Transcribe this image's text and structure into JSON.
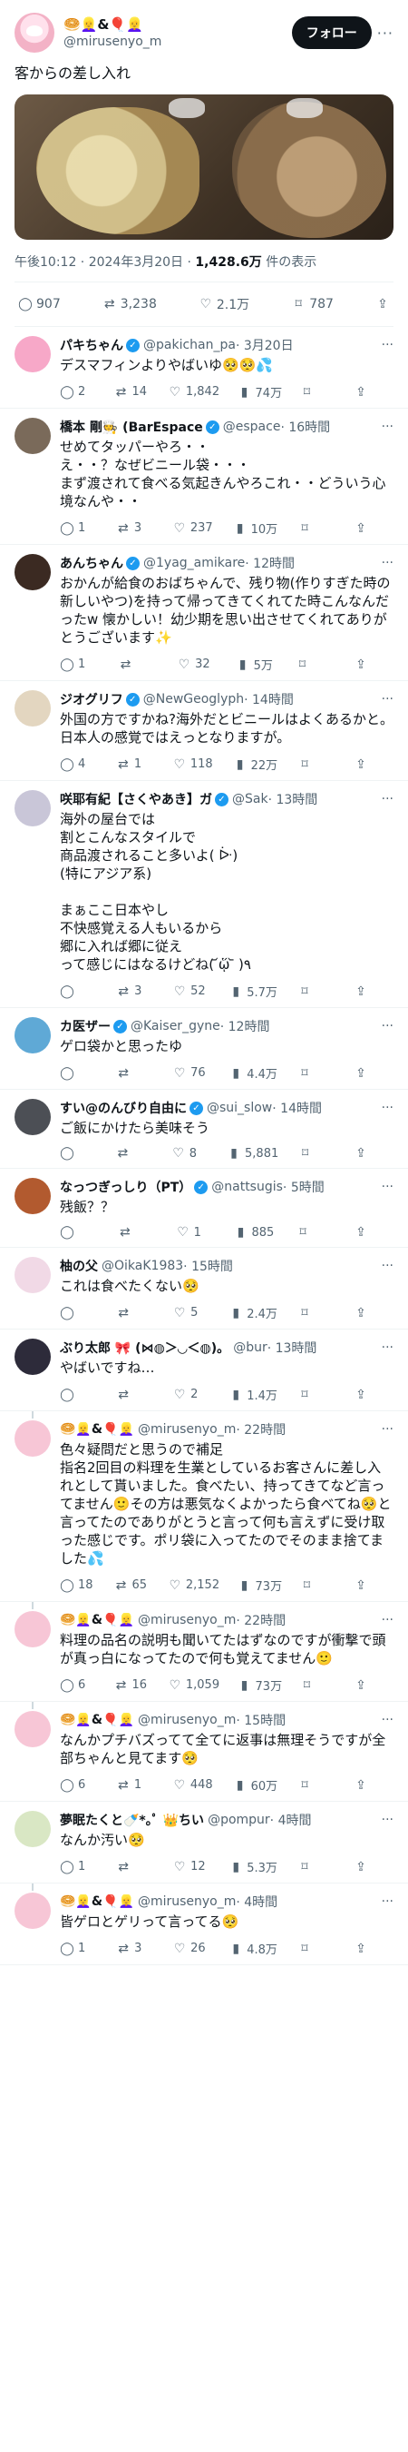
{
  "header": {
    "display_name": "🥯👱‍♀️&🎈👱‍♀️",
    "handle": "@mirusenyo_m",
    "follow_label": "フォロー",
    "more": "···"
  },
  "tweet": {
    "text": "客からの差し入れ",
    "time": "午後10:12 · 2024年3月20日 · ",
    "views_num": "1,428.6万",
    "views_label": " 件の表示",
    "replies": "907",
    "retweets": "3,238",
    "likes": "2.1万",
    "bookmarks": "787"
  },
  "replies": [
    {
      "name": "パキちゃん",
      "verified": true,
      "handle": "@pakichan_pa",
      "time": " · 3月20日",
      "text": "デスマフィンよりやばいゆ🥺🥺💦",
      "reply": "2",
      "rt": "14",
      "like": "1,842",
      "views": "74万",
      "av": "#f7a8c8"
    },
    {
      "name": "橋本 剛🧑‍🍳 (BarEspace",
      "verified": true,
      "handle": "@espace",
      "time": " · 16時間",
      "text": "せめてタッパーやろ・・\nえ・・？なぜビニール袋・・・\nまず渡されて食べる気起きんやろこれ・・どういう心境なんや・・",
      "reply": "1",
      "rt": "3",
      "like": "237",
      "views": "10万",
      "av": "#7a6a5a"
    },
    {
      "name": "あんちゃん",
      "verified": true,
      "handle": "@1yag_amikare",
      "time": " · 12時間",
      "text": "おかんが給食のおばちゃんで、残り物(作りすぎた時の新しいやつ)を持って帰ってきてくれてた時こんなんだったw 懐かしい！幼少期を思い出させてくれてありがとうございます✨",
      "reply": "1",
      "rt": "",
      "like": "32",
      "views": "5万",
      "av": "#3b2a22"
    },
    {
      "name": "ジオグリフ",
      "verified": true,
      "handle": "@NewGeoglyph",
      "time": " · 14時間",
      "text": "外国の方ですかね?海外だとビニールはよくあるかと。日本人の感覚ではえっとなりますが。",
      "reply": "4",
      "rt": "1",
      "like": "118",
      "views": "22万",
      "av": "#e3d6c0"
    },
    {
      "name": "咲耶有紀【さくやあき】ガ",
      "verified": true,
      "handle": "@Sak",
      "time": " · 13時間",
      "text": "海外の屋台では\n割とこんなスタイルで\n商品渡されること多いよ( ᐕ)\n(特にアジア系)\n\nまぁここ日本やし\n不快感覚える人もいるから\n郷に入れば郷に従え\nって感じにはなるけどね( ᷄ᾥ ᷅ )٩",
      "reply": "",
      "rt": "3",
      "like": "52",
      "views": "5.7万",
      "av": "#c9c6d8"
    },
    {
      "name": "カ医ザー",
      "verified": true,
      "handle": "@Kaiser_gyne",
      "time": " · 12時間",
      "text": "ゲロ袋かと思ったゆ",
      "reply": "",
      "rt": "",
      "like": "76",
      "views": "4.4万",
      "av": "#5fa9d6"
    },
    {
      "name": "すい@のんびり自由に",
      "verified": true,
      "handle": "@sui_slow",
      "time": " · 14時間",
      "text": "ご飯にかけたら美味そう",
      "reply": "",
      "rt": "",
      "like": "8",
      "views": "5,881",
      "av": "#4c4f55"
    },
    {
      "name": "なっつぎっしり（PT）",
      "verified": true,
      "handle": "@nattsugis",
      "time": " · 5時間",
      "text": "残飯？？",
      "reply": "",
      "rt": "",
      "like": "1",
      "views": "885",
      "av": "#b25a2f"
    },
    {
      "name": "柚の父",
      "verified": false,
      "handle": "@OikaK1983",
      "time": " · 15時間",
      "text": "これは食べたくない🥺",
      "reply": "",
      "rt": "",
      "like": "5",
      "views": "2.4万",
      "av": "#f1d9e6"
    },
    {
      "name": "ぶり太郎 🎀 (⋈◍＞◡＜◍)。",
      "verified": false,
      "handle": "@bur",
      "time": " · 13時間",
      "text": "やばいですね…",
      "reply": "",
      "rt": "",
      "like": "2",
      "views": "1.4万",
      "av": "#2d2b3a"
    },
    {
      "name": "🥯👱‍♀️&🎈👱‍♀️",
      "verified": false,
      "handle": "@mirusenyo_m",
      "time": " · 22時間",
      "text": "色々疑問だと思うので補足\n指名2回目の料理を生業としているお客さんに差し入れとして貰いました。食べたい、持ってきてなど言ってません🙂その方は悪気なくよかったら食べてね🥺と言ってたのでありがとうと言って何も言えずに受け取った感じです。ポリ袋に入ってたのでそのまま捨てました💦",
      "reply": "18",
      "rt": "65",
      "like": "2,152",
      "views": "73万",
      "av": "#f7c6d6",
      "thread": true
    },
    {
      "name": "🥯👱‍♀️&🎈👱‍♀️",
      "verified": false,
      "handle": "@mirusenyo_m",
      "time": " · 22時間",
      "text": "料理の品名の説明も聞いてたはずなのですが衝撃で頭が真っ白になってたので何も覚えてません🙂",
      "reply": "6",
      "rt": "16",
      "like": "1,059",
      "views": "73万",
      "av": "#f7c6d6",
      "thread": true
    },
    {
      "name": "🥯👱‍♀️&🎈👱‍♀️",
      "verified": false,
      "handle": "@mirusenyo_m",
      "time": " · 15時間",
      "text": "なんかプチバズってて全てに返事は無理そうですが全部ちゃんと見てます🥺",
      "reply": "6",
      "rt": "1",
      "like": "448",
      "views": "60万",
      "av": "#f7c6d6",
      "thread": true
    },
    {
      "name": "夢眠たくと🍼*｡ﾟ 👑ちい",
      "verified": false,
      "handle": "@pompur",
      "time": " · 4時間",
      "text": "なんか汚い🥺",
      "reply": "1",
      "rt": "",
      "like": "12",
      "views": "5.3万",
      "av": "#d9e7c4"
    },
    {
      "name": "🥯👱‍♀️&🎈👱‍♀️",
      "verified": false,
      "handle": "@mirusenyo_m",
      "time": " · 4時間",
      "text": "皆ゲロとゲリって言ってる🥺",
      "reply": "1",
      "rt": "3",
      "like": "26",
      "views": "4.8万",
      "av": "#f7c6d6",
      "thread": true
    }
  ],
  "icons": {
    "reply": "reply-icon",
    "retweet": "retweet-icon",
    "like": "like-icon",
    "views": "views-icon",
    "bookmark": "bookmark-icon",
    "share": "share-icon"
  }
}
